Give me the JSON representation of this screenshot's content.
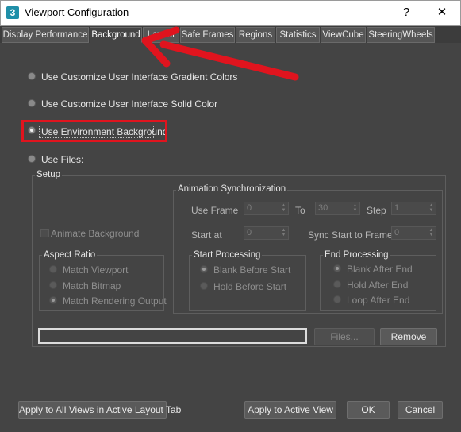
{
  "window": {
    "title": "Viewport Configuration",
    "app_icon_glyph": "3",
    "help_glyph": "?",
    "close_glyph": "✕"
  },
  "tabs": [
    {
      "label": "Display Performance",
      "active": false
    },
    {
      "label": "Background",
      "active": true
    },
    {
      "label": "Layout",
      "active": false
    },
    {
      "label": "Safe Frames",
      "active": false
    },
    {
      "label": "Regions",
      "active": false
    },
    {
      "label": "Statistics",
      "active": false
    },
    {
      "label": "ViewCube",
      "active": false
    },
    {
      "label": "SteeringWheels",
      "active": false
    }
  ],
  "background_options": [
    {
      "label": "Use Customize User Interface Gradient Colors",
      "checked": false
    },
    {
      "label": "Use Customize User Interface Solid Color",
      "checked": false
    },
    {
      "label": "Use Environment Background",
      "checked": true
    },
    {
      "label": "Use Files:",
      "checked": false
    }
  ],
  "setup": {
    "title": "Setup",
    "animate_background": {
      "label": "Animate Background",
      "checked": false,
      "enabled": false
    },
    "aspect_ratio": {
      "title": "Aspect Ratio",
      "options": [
        {
          "label": "Match Viewport",
          "checked": false
        },
        {
          "label": "Match Bitmap",
          "checked": false
        },
        {
          "label": "Match Rendering Output",
          "checked": true
        }
      ]
    },
    "animation_sync": {
      "title": "Animation Synchronization",
      "use_frame_label": "Use Frame",
      "use_frame_value": "0",
      "to_label": "To",
      "to_value": "30",
      "step_label": "Step",
      "step_value": "1",
      "start_at_label": "Start at",
      "start_at_value": "0",
      "sync_start_label": "Sync Start to Frame",
      "sync_start_value": "0"
    },
    "start_processing": {
      "title": "Start Processing",
      "options": [
        {
          "label": "Blank Before Start",
          "checked": true
        },
        {
          "label": "Hold Before Start",
          "checked": false
        }
      ]
    },
    "end_processing": {
      "title": "End Processing",
      "options": [
        {
          "label": "Blank After End",
          "checked": true
        },
        {
          "label": "Hold After End",
          "checked": false
        },
        {
          "label": "Loop After End",
          "checked": false
        }
      ]
    },
    "file_path_value": "",
    "files_button": "Files...",
    "remove_button": "Remove"
  },
  "footer": {
    "apply_all_button": "Apply to All Views in Active Layout Tab",
    "apply_active_button": "Apply to Active View",
    "ok_button": "OK",
    "cancel_button": "Cancel"
  },
  "colors": {
    "dialog_bg": "#444444",
    "annotation_red": "#e0141e",
    "title_bar_bg": "#ffffff"
  }
}
